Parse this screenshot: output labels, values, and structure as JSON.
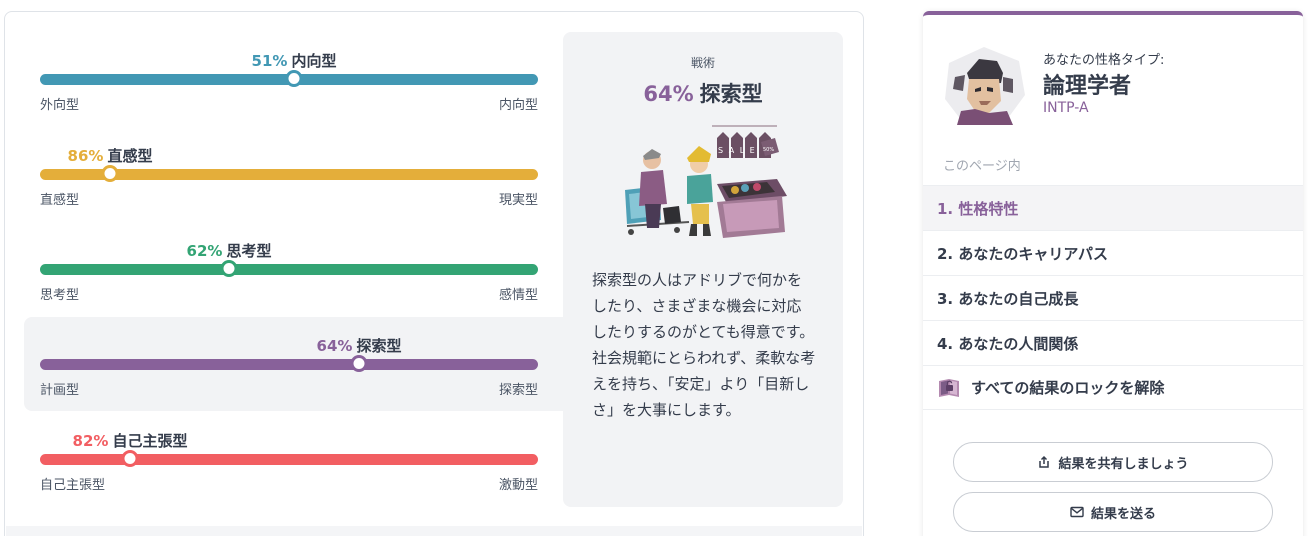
{
  "traits": [
    {
      "percent": "51%",
      "name": "内向型",
      "left_label": "外向型",
      "right_label": "内向型",
      "color": "#4298b4",
      "position": 0.51
    },
    {
      "percent": "86%",
      "name": "直感型",
      "left_label": "直感型",
      "right_label": "現実型",
      "color": "#e4ae3a",
      "position": 0.14
    },
    {
      "percent": "62%",
      "name": "思考型",
      "left_label": "思考型",
      "right_label": "感情型",
      "color": "#33a474",
      "position": 0.38
    },
    {
      "percent": "64%",
      "name": "探索型",
      "left_label": "計画型",
      "right_label": "探索型",
      "color": "#88619a",
      "position": 0.64
    },
    {
      "percent": "82%",
      "name": "自己主張型",
      "left_label": "自己主張型",
      "right_label": "激動型",
      "color": "#f25e62",
      "position": 0.18
    }
  ],
  "tactic": {
    "kicker": "戦術",
    "percent": "64%",
    "name": "探索型",
    "description": "探索型の人はアドリブで何かをしたり、さまざまな機会に対応したりするのがとても得意です。社会規範にとらわれず、柔軟な考えを持ち、「安定」より「目新しさ」を大事にします。",
    "illustration_text": "SALE",
    "illustration_tag": "50%"
  },
  "sidebar": {
    "type_kicker": "あなたの性格タイプ:",
    "type_name": "論理学者",
    "type_code": "INTP-A",
    "toc_label": "このページ内",
    "toc": [
      {
        "label": "1. 性格特性",
        "active": true
      },
      {
        "label": "2. あなたのキャリアパス",
        "active": false
      },
      {
        "label": "3. あなたの自己成長",
        "active": false
      },
      {
        "label": "4. あなたの人間関係",
        "active": false
      }
    ],
    "unlock_label": "すべての結果のロックを解除",
    "share_button": "結果を共有しましょう",
    "send_button": "結果を送る"
  },
  "colors": {
    "accent": "#88619a",
    "extraverted_introverted": "#4298b4",
    "intuitive_observant": "#e4ae3a",
    "thinking_feeling": "#33a474",
    "judging_prospecting": "#88619a",
    "assertive_turbulent": "#f25e62"
  }
}
